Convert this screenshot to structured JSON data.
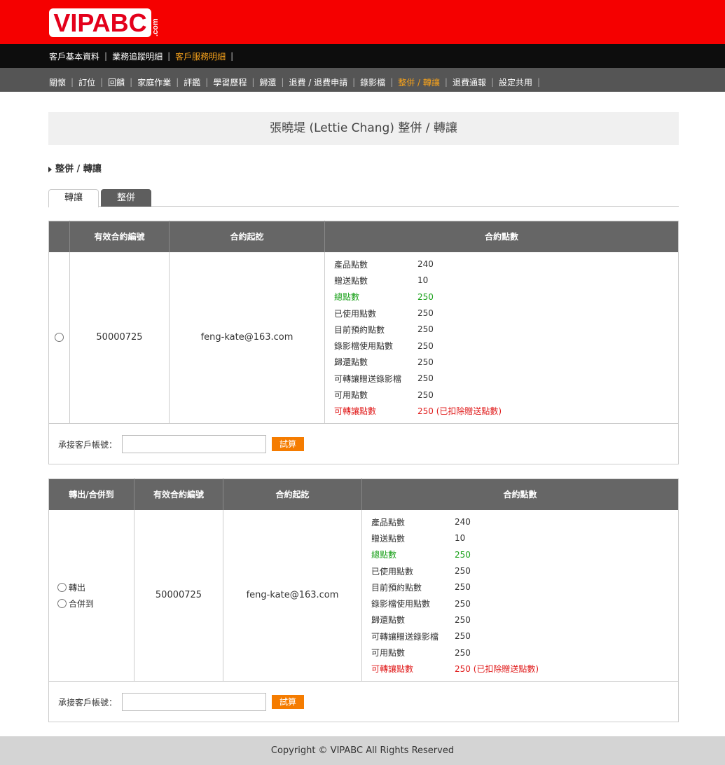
{
  "brand": {
    "logo_text": "VIPABC",
    "logo_suffix": ".com"
  },
  "nav_primary": [
    {
      "label": "客戶基本資料",
      "active": false
    },
    {
      "label": "業務追蹤明細",
      "active": false
    },
    {
      "label": "客戶服務明細",
      "active": true
    }
  ],
  "nav_secondary": [
    {
      "label": "關懷",
      "active": false
    },
    {
      "label": "訂位",
      "active": false
    },
    {
      "label": "回饋",
      "active": false
    },
    {
      "label": "家庭作業",
      "active": false
    },
    {
      "label": "評鑑",
      "active": false
    },
    {
      "label": "學習歷程",
      "active": false
    },
    {
      "label": "歸還",
      "active": false
    },
    {
      "label": "退費 / 退費申請",
      "active": false
    },
    {
      "label": "錄影檔",
      "active": false
    },
    {
      "label": "整併 / 轉讓",
      "active": true
    },
    {
      "label": "退費通報",
      "active": false
    },
    {
      "label": "設定共用",
      "active": false
    }
  ],
  "page_title": "張曉堤 (Lettie Chang) 整併 / 轉讓",
  "section_title": "整併 / 轉讓",
  "tabs": [
    {
      "label": "轉讓",
      "active": true
    },
    {
      "label": "整併",
      "active": false
    }
  ],
  "table1": {
    "headers": [
      "",
      "有效合約編號",
      "合約起訖",
      "合約點數"
    ],
    "contract_no": "50000725",
    "contract_period": "feng-kate@163.com",
    "points": [
      {
        "k": "產品點數",
        "v": "240",
        "style": ""
      },
      {
        "k": "贈送點數",
        "v": "10",
        "style": ""
      },
      {
        "k": "總點數",
        "v": "250",
        "style": "green"
      },
      {
        "k": "已使用點數",
        "v": "250",
        "style": ""
      },
      {
        "k": "目前預約點數",
        "v": "250",
        "style": ""
      },
      {
        "k": "錄影檔使用點數",
        "v": "250",
        "style": ""
      },
      {
        "k": "歸還點數",
        "v": "250",
        "style": ""
      },
      {
        "k": "可轉讓贈送錄影檔",
        "v": "250",
        "style": ""
      },
      {
        "k": "可用點數",
        "v": "250",
        "style": ""
      },
      {
        "k": "可轉讓點數",
        "v": "250 (已扣除贈送點數)",
        "style": "red"
      }
    ],
    "trial_label": "承接客戶帳號：",
    "trial_button": "試算"
  },
  "table2": {
    "headers": [
      "轉出/合併到",
      "有效合約編號",
      "合約起訖",
      "合約點數"
    ],
    "radio_options": [
      "轉出",
      "合併到"
    ],
    "contract_no": "50000725",
    "contract_period": "feng-kate@163.com",
    "points": [
      {
        "k": "產品點數",
        "v": "240",
        "style": ""
      },
      {
        "k": "贈送點數",
        "v": "10",
        "style": ""
      },
      {
        "k": "總點數",
        "v": "250",
        "style": "green"
      },
      {
        "k": "已使用點數",
        "v": "250",
        "style": ""
      },
      {
        "k": "目前預約點數",
        "v": "250",
        "style": ""
      },
      {
        "k": "錄影檔使用點數",
        "v": "250",
        "style": ""
      },
      {
        "k": "歸還點數",
        "v": "250",
        "style": ""
      },
      {
        "k": "可轉讓贈送錄影檔",
        "v": "250",
        "style": ""
      },
      {
        "k": "可用點數",
        "v": "250",
        "style": ""
      },
      {
        "k": "可轉讓點數",
        "v": "250 (已扣除贈送點數)",
        "style": "red"
      }
    ],
    "trial_label": "承接客戶帳號：",
    "trial_button": "試算"
  },
  "footer": "Copyright © VIPABC All Rights Reserved",
  "colors": {
    "brand_red": "#f50000",
    "accent_orange": "#f7a21b",
    "button_orange": "#f57c00",
    "green": "#18a018",
    "red": "#e01b1b"
  }
}
